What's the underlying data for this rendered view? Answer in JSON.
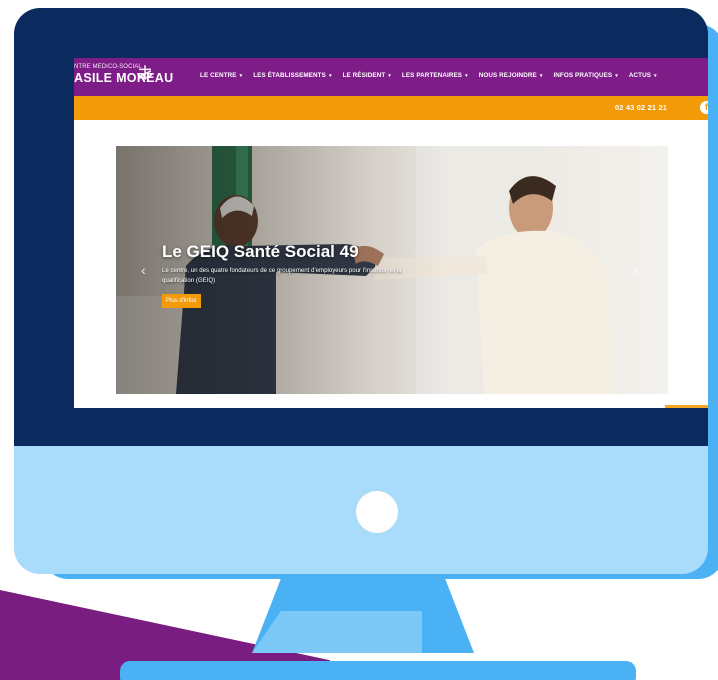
{
  "logo": {
    "line1": "NTRE MÉDICO-SOCIAL",
    "line2": "ASILE MOREAU",
    "mark_icon": "anchor-cross-icon"
  },
  "nav": {
    "items": [
      {
        "label": "LE CENTRE"
      },
      {
        "label": "LES ÉTABLISSEMENTS"
      },
      {
        "label": "LE RÉSIDENT"
      },
      {
        "label": "LES PARTENAIRES"
      },
      {
        "label": "NOUS REJOINDRE"
      },
      {
        "label": "INFOS PRATIQUES"
      },
      {
        "label": "ACTUS"
      }
    ],
    "caret": "▾"
  },
  "topbar": {
    "phone": "02 43 02 21 21",
    "social_icon": "facebook-icon"
  },
  "slider": {
    "title": "Le GEIQ Santé Social 49",
    "text": "Le centre, un des quatre fondateurs de ce groupement d'employeurs pour l'insertion et la qualification (GEIQ)",
    "button": "Plus d'infos",
    "prev_icon": "‹",
    "next_icon": "›"
  },
  "colors": {
    "nav_purple": "#7e1d88",
    "topbar_orange": "#f29a07",
    "monitor_bezel": "#0b2a5e",
    "monitor_chin": "#a9dbfb",
    "stand_blue": "#4ab2f4",
    "decoration_purple": "#7a1d80"
  }
}
